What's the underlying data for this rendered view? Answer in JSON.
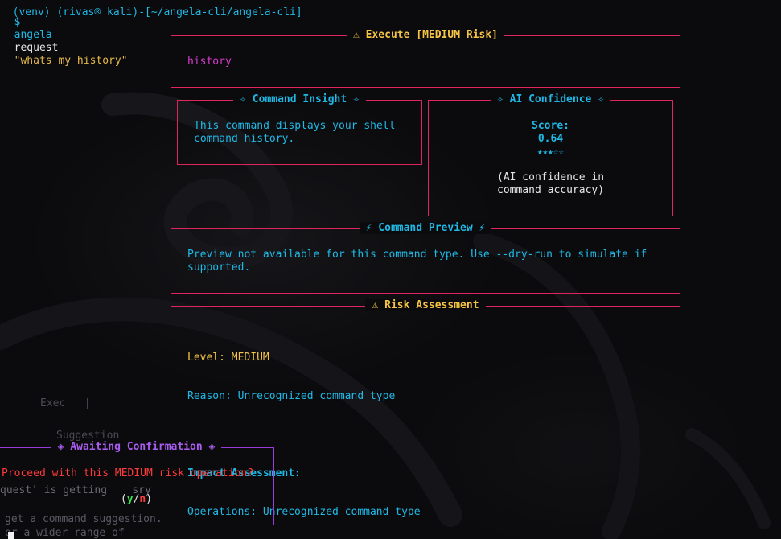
{
  "terminal": {
    "prompt_prev": "(venv) (rivas® kali)-[~/angela-cli/angela-cli]",
    "prompt_arrow": "$",
    "cmd_name": "angela",
    "cmd_sub": "request",
    "cmd_arg": "\"whats my history\""
  },
  "execute_panel": {
    "title": "⚠ Execute [MEDIUM Risk]",
    "command": "history"
  },
  "insight_panel": {
    "title": "✧ Command Insight ✧",
    "text": "This command displays your shell\ncommand history."
  },
  "confidence_panel": {
    "title": "✧ AI Confidence ✧",
    "score_label": "Score:",
    "score_value": "0.64",
    "stars": "★★★☆☆",
    "note": "(AI confidence in\ncommand accuracy)"
  },
  "preview_panel": {
    "title": "⚡ Command Preview ⚡",
    "text": "Preview not available for this command type. Use --dry-run to simulate if\nsupported."
  },
  "risk_panel": {
    "title": "⚠ Risk Assessment",
    "level_label": "Level:",
    "level_value": "MEDIUM",
    "reason_label": "Reason:",
    "reason_value": "Unrecognized command type",
    "impact_title": "Impact Assessment:",
    "operations_label": "Operations:",
    "operations_value": "Unrecognized command type"
  },
  "confirm_panel": {
    "title": "◈ Awaiting Confirmation ◈",
    "question": "Proceed with this MEDIUM risk operation?",
    "open_paren": "(",
    "yes": "y",
    "slash": "/",
    "no": "n",
    "close_paren": ")"
  },
  "background_text": {
    "line1": "Exec   |",
    "line2": "Suggestion",
    "line3": "quest' is getting    sry",
    "line4": "get a command suggestion.",
    "line5": "or a wider range of"
  },
  "colors": {
    "panel_border": "#e0245e",
    "confirm_border": "#9b3bd9",
    "title_yellow": "#f6c445",
    "title_cyan": "#1fb9e6",
    "command_magenta": "#d93bd0"
  }
}
